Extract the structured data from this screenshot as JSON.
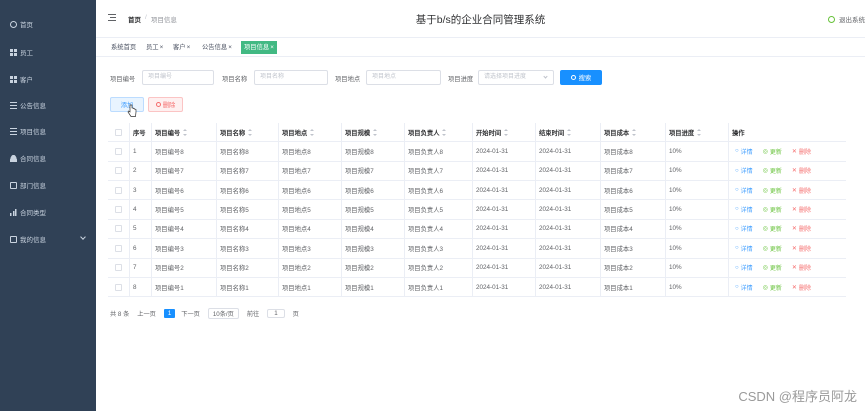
{
  "sidebar": {
    "items": [
      {
        "label": "首页",
        "icon": "home-icon"
      },
      {
        "label": "员工",
        "icon": "grid-icon"
      },
      {
        "label": "客户",
        "icon": "grid-icon"
      },
      {
        "label": "公告信息",
        "icon": "menu-icon"
      },
      {
        "label": "项目信息",
        "icon": "menu-icon"
      },
      {
        "label": "合同信息",
        "icon": "user-icon"
      },
      {
        "label": "部门信息",
        "icon": "card-icon"
      },
      {
        "label": "合同类型",
        "icon": "chart-icon"
      },
      {
        "label": "我的信息",
        "icon": "card-icon"
      }
    ]
  },
  "header": {
    "breadcrumb": [
      "首页",
      "项目信息"
    ],
    "title": "基于b/s的企业合同管理系统",
    "logout": "退出系统"
  },
  "tags": [
    {
      "label": "系统首页",
      "closable": false,
      "active": false
    },
    {
      "label": "员工",
      "closable": true,
      "active": false
    },
    {
      "label": "客户",
      "closable": true,
      "active": false
    },
    {
      "label": "公告信息",
      "closable": true,
      "active": false
    },
    {
      "label": "项目信息",
      "closable": true,
      "active": true
    }
  ],
  "search": {
    "fields": [
      {
        "label": "项目编号",
        "placeholder": "项目编号"
      },
      {
        "label": "项目名称",
        "placeholder": "项目名称"
      },
      {
        "label": "项目地点",
        "placeholder": "项目地点"
      },
      {
        "label": "项目进度",
        "placeholder": "请选择项目进度"
      }
    ],
    "search_button": "搜索"
  },
  "actions": {
    "add": "添加",
    "delete": "删除"
  },
  "table": {
    "columns": [
      "序号",
      "项目编号",
      "项目名称",
      "项目地点",
      "项目规模",
      "项目负责人",
      "开始时间",
      "结束时间",
      "项目成本",
      "项目进度",
      "操作"
    ],
    "op_labels": {
      "detail": "详情",
      "edit": "更新",
      "delete": "删除"
    },
    "rows": [
      [
        "1",
        "项目编号8",
        "项目名称8",
        "项目地点8",
        "项目规模8",
        "项目负责人8",
        "2024-01-31",
        "2024-01-31",
        "项目成本8",
        "10%"
      ],
      [
        "2",
        "项目编号7",
        "项目名称7",
        "项目地点7",
        "项目规模7",
        "项目负责人7",
        "2024-01-31",
        "2024-01-31",
        "项目成本7",
        "10%"
      ],
      [
        "3",
        "项目编号6",
        "项目名称6",
        "项目地点6",
        "项目规模6",
        "项目负责人6",
        "2024-01-31",
        "2024-01-31",
        "项目成本6",
        "10%"
      ],
      [
        "4",
        "项目编号5",
        "项目名称5",
        "项目地点5",
        "项目规模5",
        "项目负责人5",
        "2024-01-31",
        "2024-01-31",
        "项目成本5",
        "10%"
      ],
      [
        "5",
        "项目编号4",
        "项目名称4",
        "项目地点4",
        "项目规模4",
        "项目负责人4",
        "2024-01-31",
        "2024-01-31",
        "项目成本4",
        "10%"
      ],
      [
        "6",
        "项目编号3",
        "项目名称3",
        "项目地点3",
        "项目规模3",
        "项目负责人3",
        "2024-01-31",
        "2024-01-31",
        "项目成本3",
        "10%"
      ],
      [
        "7",
        "项目编号2",
        "项目名称2",
        "项目地点2",
        "项目规模2",
        "项目负责人2",
        "2024-01-31",
        "2024-01-31",
        "项目成本2",
        "10%"
      ],
      [
        "8",
        "项目编号1",
        "项目名称1",
        "项目地点1",
        "项目规模1",
        "项目负责人1",
        "2024-01-31",
        "2024-01-31",
        "项目成本1",
        "10%"
      ]
    ]
  },
  "pagination": {
    "total": "共 8 条",
    "prev": "上一页",
    "current": "1",
    "next": "下一页",
    "page_size": "10条/页",
    "goto_label": "前往",
    "goto_value": "1",
    "page_unit": "页"
  },
  "watermark": "CSDN @程序员阿龙",
  "colors": {
    "sidebar_bg": "#304156",
    "active_tag": "#42b983",
    "primary": "#1890ff",
    "danger": "#f56c6c",
    "success": "#67c23a"
  }
}
